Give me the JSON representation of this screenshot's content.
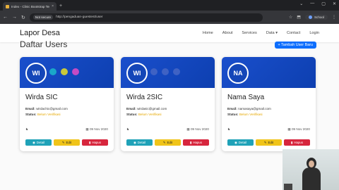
{
  "browser": {
    "tab_title": "Index - Clinic Bootstrap Templ",
    "security": "Not secure",
    "url": "http://pengaduan-guestest/user",
    "profile": "School"
  },
  "navbar": {
    "brand": "Lapor Desa",
    "menu": [
      "Home",
      "About",
      "Services",
      "Data ▾",
      "Contact",
      "Login"
    ]
  },
  "section": {
    "title": "Daftar Users",
    "add_button": "+ Tambah User Baru"
  },
  "cards": [
    {
      "initials": "WI",
      "name": "Wirda SIC",
      "email_label": "Email:",
      "email": "wirdachic@gmail.com",
      "status_label": "Status:",
      "status": "Belum Verifikasi",
      "date": "09 Nov 2020",
      "detail": "Detail",
      "edit": "Edit",
      "delete": "Hapus",
      "dots": [
        "#1aa7c9",
        "#c8c83a",
        "#c44bc4"
      ]
    },
    {
      "initials": "WI",
      "name": "Wirda 2SIC",
      "email_label": "Email:",
      "email": "wirdasic@gmail.com",
      "status_label": "Status:",
      "status": "Belum Verifikasi",
      "date": "09 Nov 2020",
      "detail": "Detail",
      "edit": "Edit",
      "delete": "Hapus",
      "dots": [
        "#3f62c4",
        "#3f62c4",
        "#3f62c4"
      ]
    },
    {
      "initials": "NA",
      "name": "Nama Saya",
      "email_label": "Email:",
      "email": "namasaya@gmail.com",
      "status_label": "Status:",
      "status": "Belum Verifikasi",
      "date": "09 Nov 2020",
      "detail": "Detail",
      "edit": "Edit",
      "delete": "Hapus",
      "dots": []
    }
  ]
}
